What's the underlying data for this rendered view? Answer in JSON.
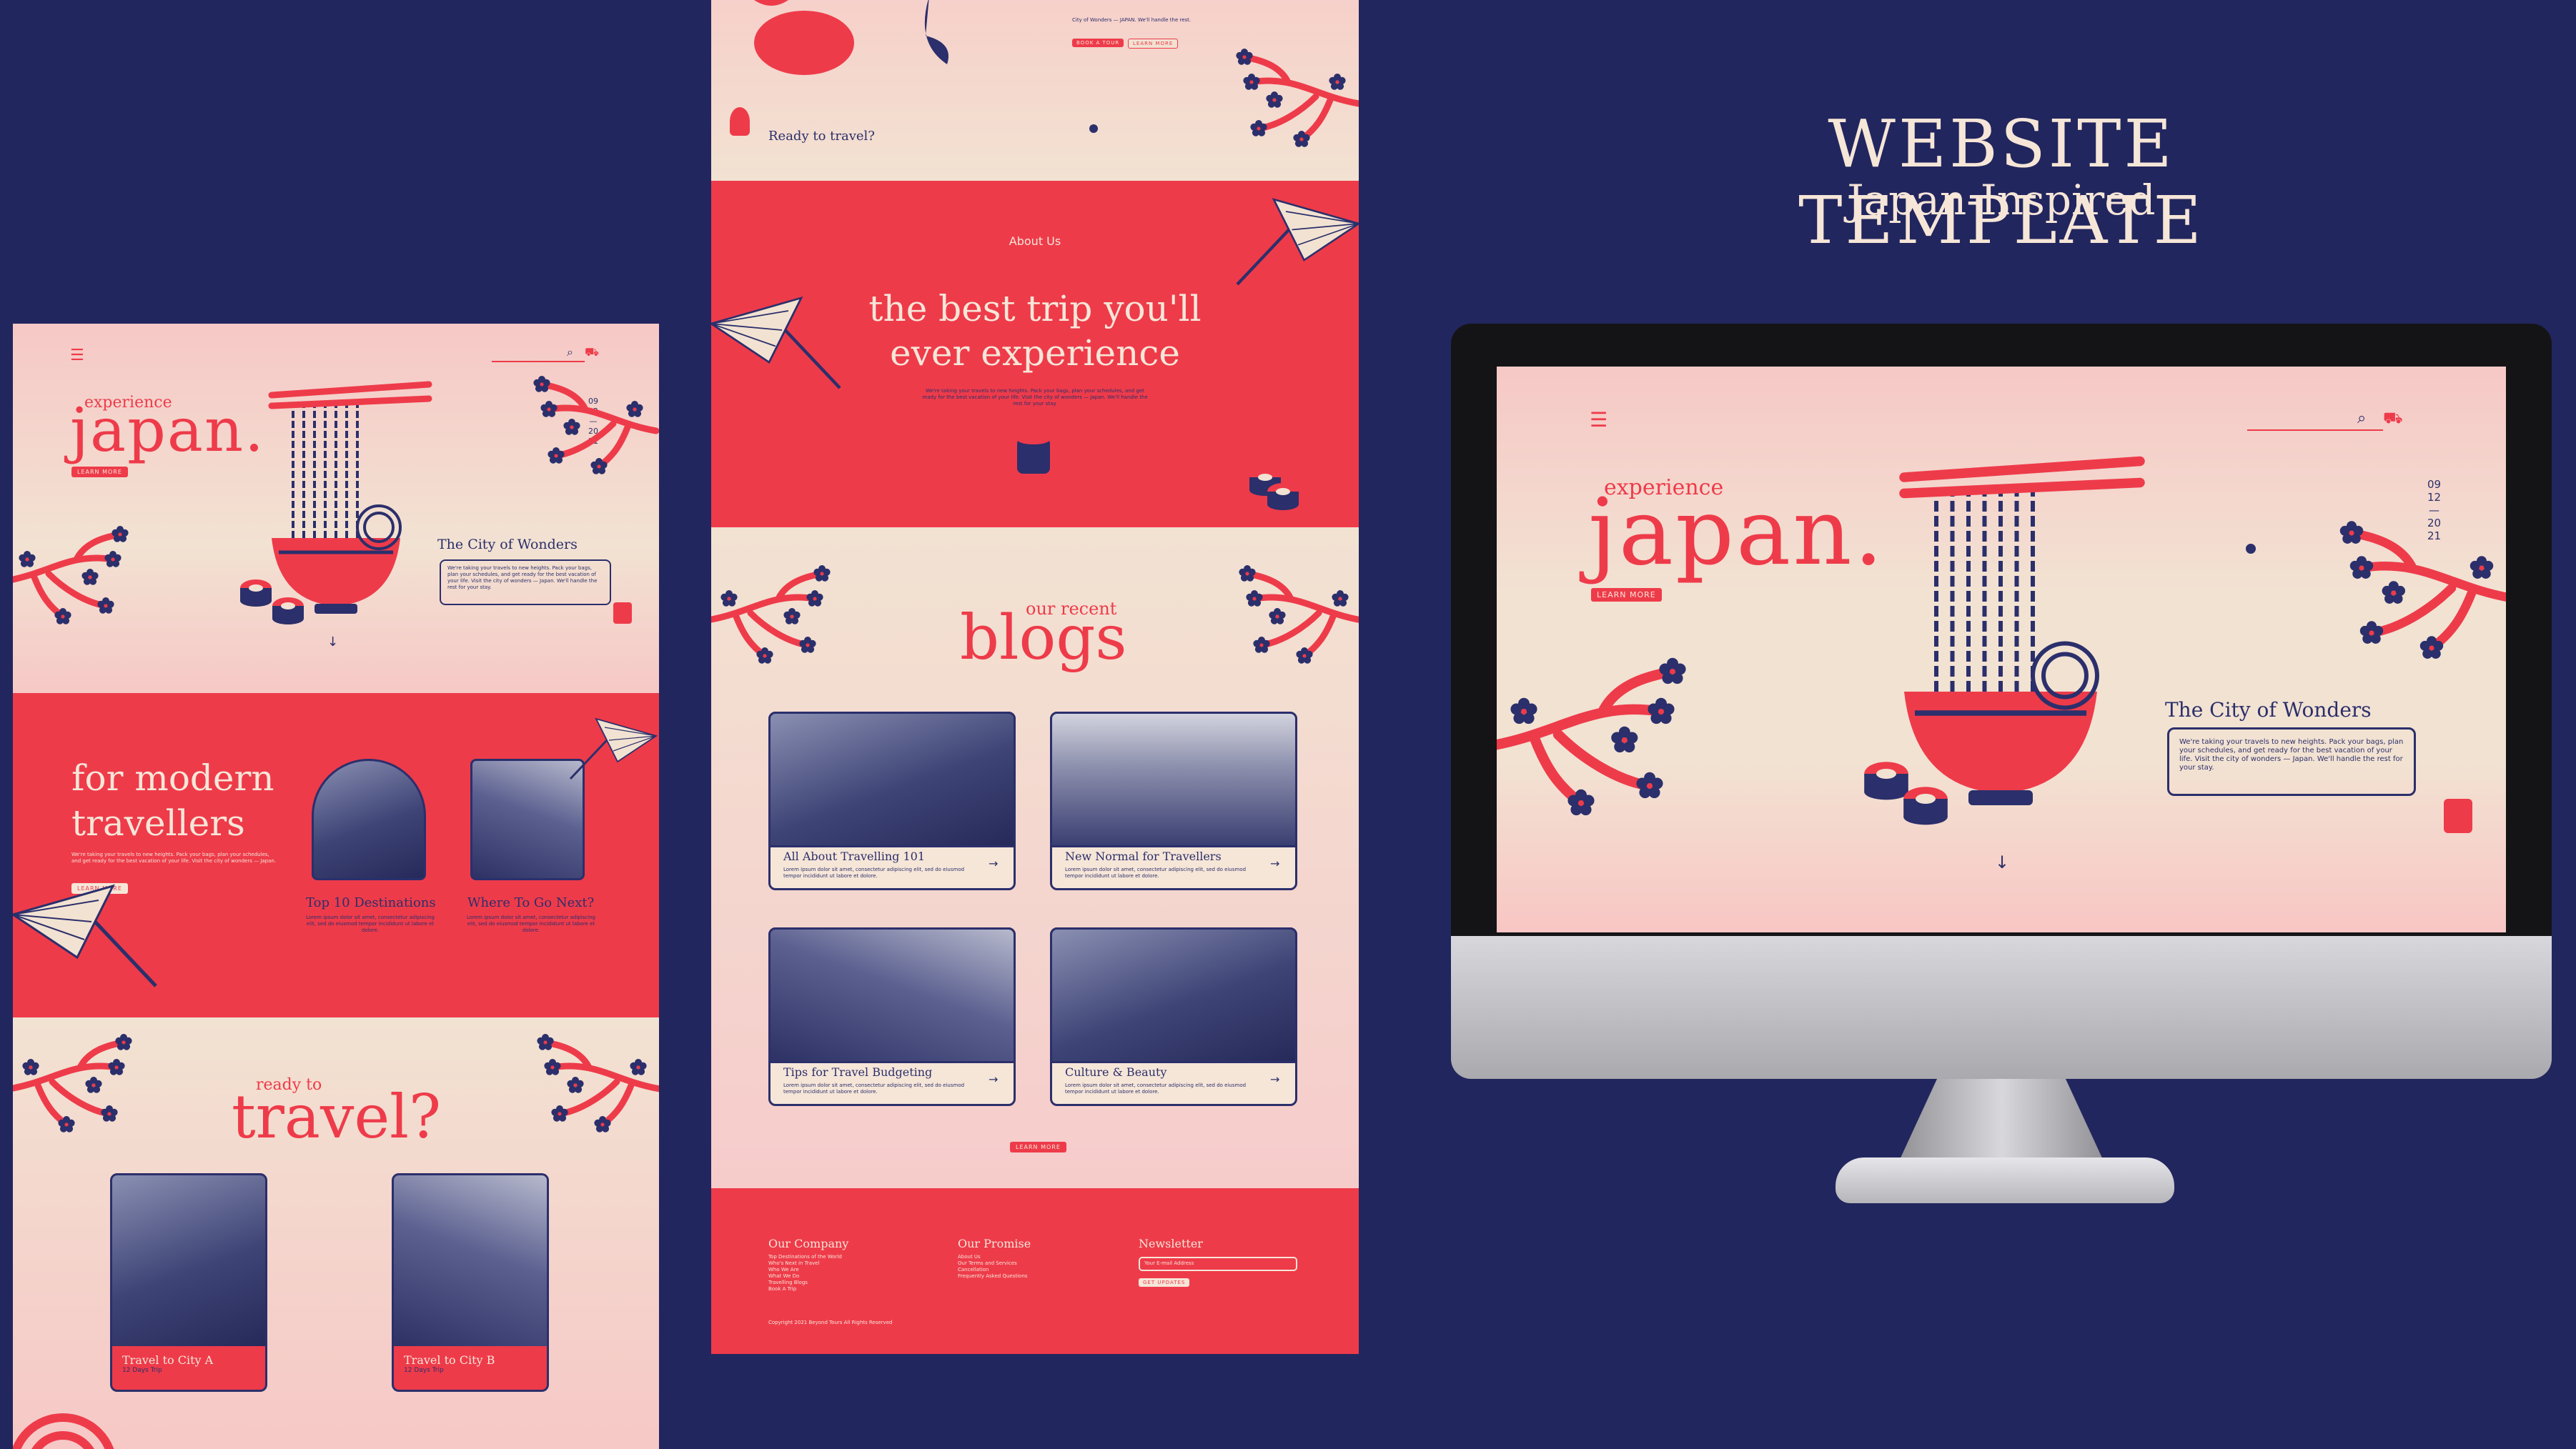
{
  "heading": {
    "title": "WEBSITE TEMPLATE",
    "subtitle": "Japan-Inspired"
  },
  "colors": {
    "background": "#22265e",
    "accent": "#ee3b4a",
    "cream": "#f2e2d2",
    "navy": "#2b2f6b",
    "pink": "#f6c8c6"
  },
  "hero": {
    "kicker": "experience",
    "title": "japan.",
    "cta": "LEARN MORE",
    "dates": [
      "09",
      "12",
      "—",
      "20",
      "21"
    ],
    "section_title": "The City of Wonders",
    "section_text": "We're taking your travels to new heights. Pack your bags, plan your schedules, and get ready for the best vacation of your life. Visit the city of wonders — Japan. We'll handle the rest for your stay.",
    "scroll_arrow": "↓"
  },
  "modern": {
    "title_line1": "for modern",
    "title_line2": "travellers",
    "text": "We're taking your travels to new heights. Pack your bags, plan your schedules, and get ready for the best vacation of your life. Visit the city of wonders — Japan.",
    "cta": "LEARN MORE",
    "cards": [
      {
        "title": "Top 10 Destinations",
        "text": "Lorem ipsum dolor sit amet, consectetur adipiscing elit, sed do eiusmod tempor incididunt ut labore et dolore."
      },
      {
        "title": "Where To Go Next?",
        "text": "Lorem ipsum dolor sit amet, consectetur adipiscing elit, sed do eiusmod tempor incididunt ut labore et dolore."
      }
    ]
  },
  "ready": {
    "kicker": "ready to",
    "title": "travel?",
    "cities": [
      {
        "title": "Travel to City A",
        "sub": "12 Days Trip"
      },
      {
        "title": "Travel to City B",
        "sub": "12 Days Trip"
      }
    ]
  },
  "mid_top": {
    "small_text": "City of Wonders — JAPAN. We'll handle the rest.",
    "btn_tour": "BOOK A TOUR",
    "btn_more": "LEARN MORE",
    "ready_label": "Ready to travel?"
  },
  "about": {
    "label": "About Us",
    "title_line1": "the best trip you'll",
    "title_line2": "ever experience",
    "text": "We're taking your travels to new heights. Pack your bags, plan your schedules, and get ready for the best vacation of your life. Visit the city of wonders — Japan. We'll handle the rest for your stay."
  },
  "blogs": {
    "kicker": "our recent",
    "title": "blogs",
    "posts": [
      {
        "title": "All About Travelling 101",
        "text": "Lorem ipsum dolor sit amet, consectetur adipiscing elit, sed do eiusmod tempor incididunt ut labore et dolore."
      },
      {
        "title": "New Normal for Travellers",
        "text": "Lorem ipsum dolor sit amet, consectetur adipiscing elit, sed do eiusmod tempor incididunt ut labore et dolore."
      },
      {
        "title": "Tips for Travel Budgeting",
        "text": "Lorem ipsum dolor sit amet, consectetur adipiscing elit, sed do eiusmod tempor incididunt ut labore et dolore."
      },
      {
        "title": "Culture & Beauty",
        "text": "Lorem ipsum dolor sit amet, consectetur adipiscing elit, sed do eiusmod tempor incididunt ut labore et dolore."
      }
    ],
    "arrow": "→",
    "cta": "LEARN MORE"
  },
  "footer": {
    "col1_title": "Our Company",
    "col1_items": [
      "Top Destinations of the World",
      "Who's Next in Travel",
      "Who We Are",
      "What We Do",
      "Travelling Blogs",
      "Book A Trip"
    ],
    "col2_title": "Our Promise",
    "col2_items": [
      "About Us",
      "Our Terms and Services",
      "Cancellation",
      "Frequently Asked Questions"
    ],
    "col3_title": "Newsletter",
    "email_placeholder": "Your E-mail Address",
    "subscribe": "GET UPDATES",
    "copyright": "Copyright 2021 Beyond Tours All Rights Reserved"
  }
}
